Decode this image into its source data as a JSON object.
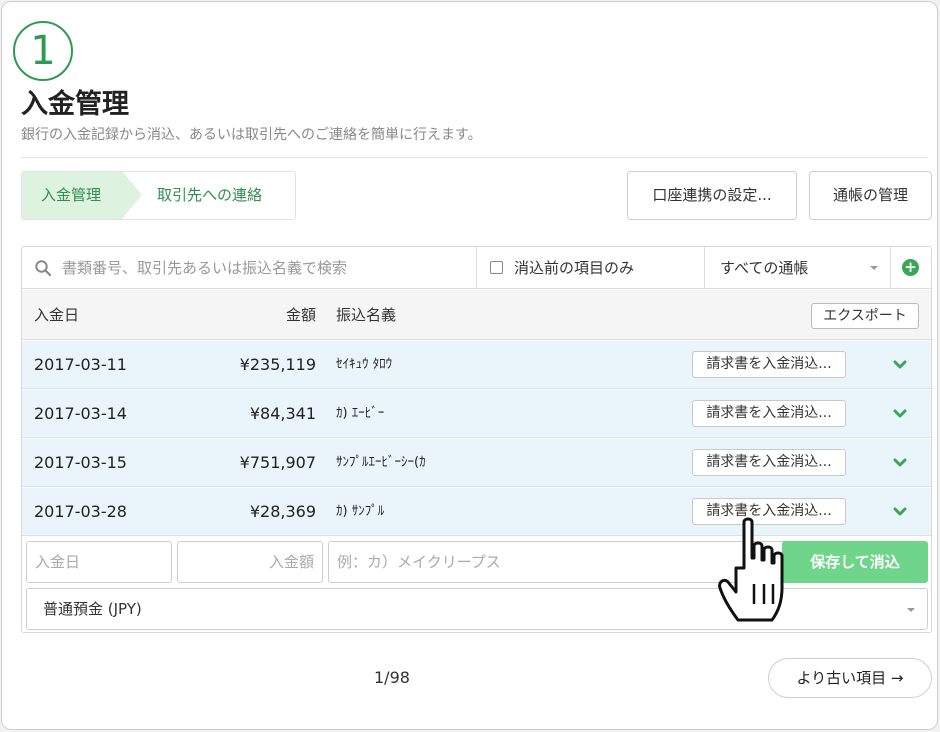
{
  "step_number": "1",
  "page": {
    "title": "入金管理",
    "subtitle": "銀行の入金記録から消込、あるいは取引先へのご連絡を簡単に行えます。"
  },
  "breadcrumb": {
    "active": "入金管理",
    "next": "取引先への連絡"
  },
  "header_buttons": {
    "account_link": "口座連携の設定...",
    "passbook": "通帳の管理"
  },
  "filter": {
    "search_placeholder": "書類番号、取引先あるいは振込名義で検索",
    "unreconciled_only": "消込前の項目のみ",
    "passbook_select": "すべての通帳",
    "add_icon": "plus-circle-icon"
  },
  "table": {
    "columns": {
      "date": "入金日",
      "amount": "金額",
      "name": "振込名義"
    },
    "export_label": "エクスポート",
    "rows": [
      {
        "date": "2017-03-11",
        "amount": "¥235,119",
        "name": "ｾｲｷｭｳ ﾀﾛｳ",
        "action": "請求書を入金消込..."
      },
      {
        "date": "2017-03-14",
        "amount": "¥84,341",
        "name": "ｶ) ｴｰﾋﾞｰ",
        "action": "請求書を入金消込..."
      },
      {
        "date": "2017-03-15",
        "amount": "¥751,907",
        "name": "ｻﾝﾌﾟﾙｴｰﾋﾞｰｼｰ(ｶ",
        "action": "請求書を入金消込..."
      },
      {
        "date": "2017-03-28",
        "amount": "¥28,369",
        "name": "ｶ) ｻﾝﾌﾟﾙ",
        "action": "請求書を入金消込..."
      }
    ]
  },
  "new_entry": {
    "date_placeholder": "入金日",
    "amount_placeholder": "入金額",
    "name_placeholder": "例：カ）メイクリープス",
    "save_label": "保存して消込",
    "account_value": "普通預金 (JPY)"
  },
  "pagination": {
    "page_indicator": "1/98",
    "older_label": "より古い項目 →"
  },
  "colors": {
    "accent_green": "#2f9b52",
    "row_highlight": "#eaf4fb",
    "save_button": "#6fd58b"
  }
}
